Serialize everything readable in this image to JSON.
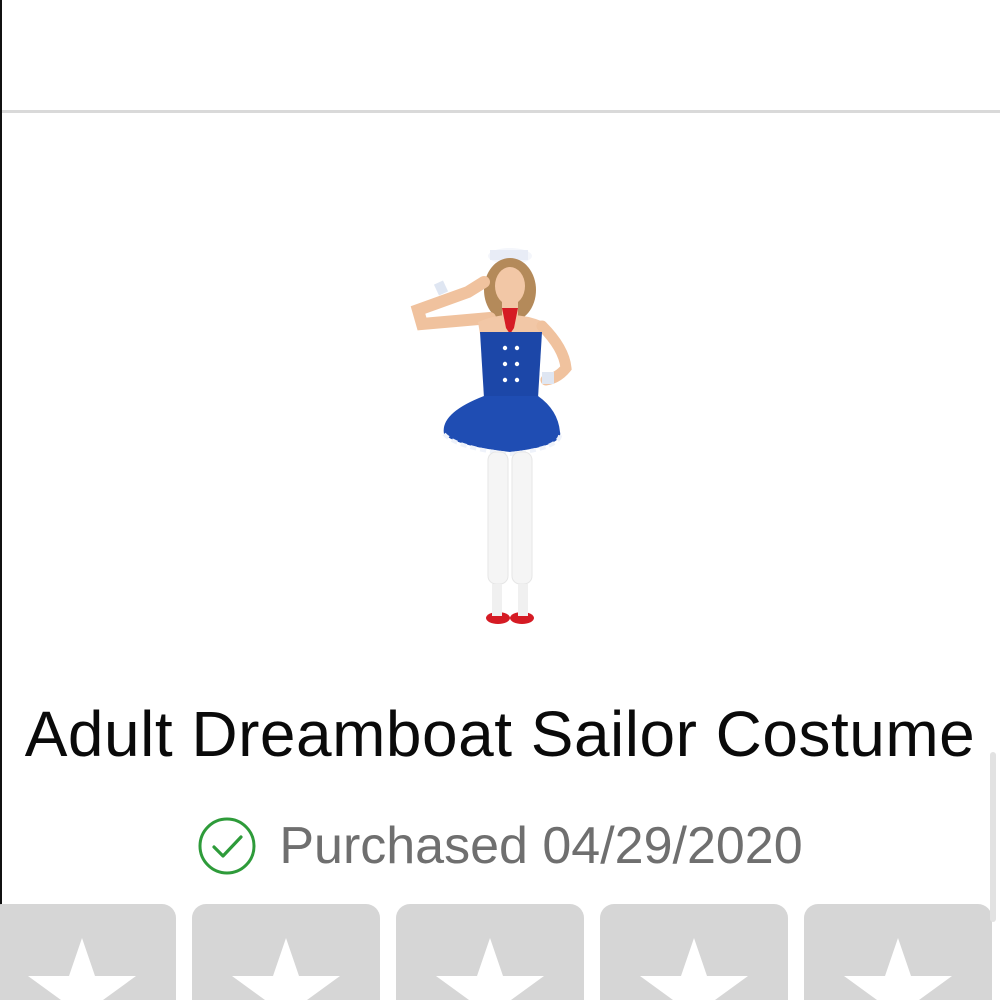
{
  "product": {
    "title": "Adult Dreamboat Sailor Costume",
    "image_name": "sailor-costume-photo"
  },
  "purchase": {
    "label": "Purchased 04/29/2020",
    "icon": "check-circle-icon",
    "icon_color": "#2e9b3a"
  },
  "rating": {
    "stars": [
      {
        "icon": "star-icon"
      },
      {
        "icon": "star-icon"
      },
      {
        "icon": "star-icon"
      },
      {
        "icon": "star-icon"
      },
      {
        "icon": "star-icon"
      }
    ],
    "selected": 0,
    "box_color": "#d6d6d6",
    "star_color": "#ffffff"
  }
}
